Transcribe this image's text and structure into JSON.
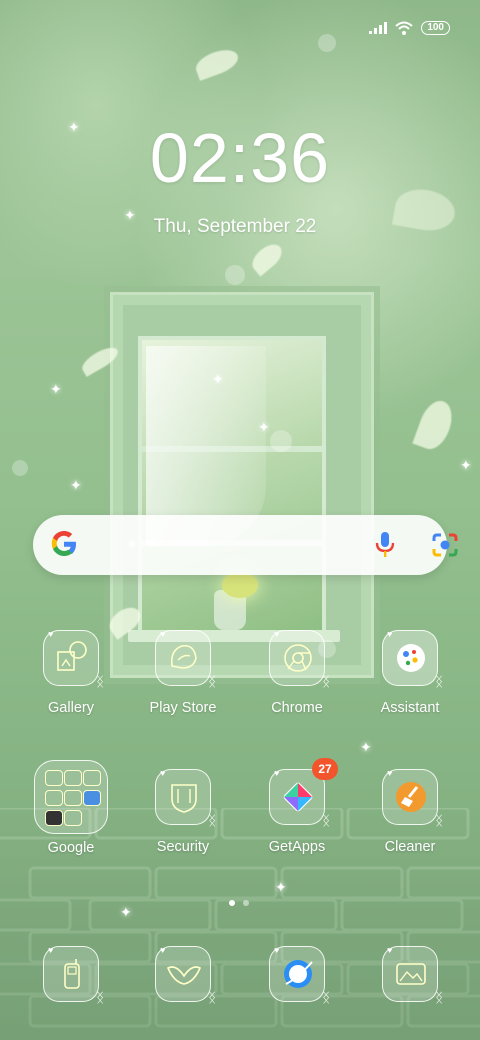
{
  "status": {
    "battery": "100",
    "signal_icon": "signal-bars-icon",
    "wifi_icon": "wifi-icon"
  },
  "lock": {
    "time": "02:36",
    "date": "Thu, September 22"
  },
  "search": {
    "google_icon": "google-g-icon",
    "mic_icon": "microphone-icon",
    "lens_icon": "google-lens-icon"
  },
  "apps_row1": [
    {
      "label": "Gallery",
      "icon": "gallery-icon"
    },
    {
      "label": "Play Store",
      "icon": "play-store-icon"
    },
    {
      "label": "Chrome",
      "icon": "chrome-icon"
    },
    {
      "label": "Assistant",
      "icon": "assistant-icon"
    }
  ],
  "apps_row2": [
    {
      "label": "Google",
      "icon": "folder-icon"
    },
    {
      "label": "Security",
      "icon": "shield-icon"
    },
    {
      "label": "GetApps",
      "icon": "getapps-icon",
      "badge": "27"
    },
    {
      "label": "Cleaner",
      "icon": "broom-icon"
    }
  ],
  "dock": [
    {
      "icon": "phone-icon"
    },
    {
      "icon": "messages-icon"
    },
    {
      "icon": "browser-icon"
    },
    {
      "icon": "photo-icon"
    }
  ],
  "pager": {
    "pages": 2,
    "active": 1
  },
  "colors": {
    "badge": "#f2552c",
    "google_blue": "#4285F4",
    "google_red": "#EA4335",
    "google_yellow": "#FBBC05",
    "google_green": "#34A853"
  }
}
